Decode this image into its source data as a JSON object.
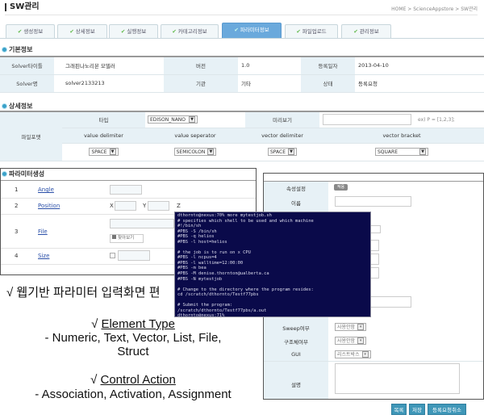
{
  "header": {
    "title": "SW관리",
    "breadcrumb": "HOME > ScienceAppstore > SW관리"
  },
  "tabs": [
    {
      "label": "생성정보"
    },
    {
      "label": "상세정보"
    },
    {
      "label": "실행정보"
    },
    {
      "label": "카테고리정보"
    },
    {
      "label": "파라미터정보",
      "active": true
    },
    {
      "label": "파일업로드"
    },
    {
      "label": "관리정보"
    }
  ],
  "basic": {
    "heading": "기본정보",
    "rows": [
      {
        "l1": "Solver타이틀",
        "v1": "그래핀나노리본 모델러",
        "l2": "버전",
        "v2": "1.0",
        "l3": "등록일자",
        "v3": "2013-04-10"
      },
      {
        "l1": "Solver명",
        "v1": "solver2133213",
        "l2": "기관",
        "v2": "기타",
        "l3": "상태",
        "v3": "등록요청"
      }
    ]
  },
  "detail": {
    "heading": "상세정보",
    "file_format": "파일포맷",
    "type_label": "타입",
    "type_value": "EDISON_NANO",
    "preview_label": "미리보기",
    "preview_value": "",
    "example": "ex) P = [1,2,3];",
    "cols": [
      "value delimiter",
      "value seperator",
      "vector delimiter",
      "vector bracket"
    ],
    "values": [
      "SPACE",
      "SEMICOLON",
      "SPACE",
      "SQUARE"
    ]
  },
  "params": {
    "heading": "파라미터생성",
    "rows": [
      {
        "no": "1",
        "name": "Angle"
      },
      {
        "no": "2",
        "name": "Position"
      },
      {
        "no": "3",
        "name": "File"
      },
      {
        "no": "4",
        "name": "Size"
      }
    ],
    "x": "X",
    "y": "Y",
    "z": "Z",
    "browse": "찾아보기"
  },
  "props": {
    "attr_label": "속성설정",
    "attr_btn": "적용",
    "name_label": "이름",
    "sweep_label": "Sweep여부",
    "sweep_value": "사용안함",
    "struct_label": "구조체여부",
    "struct_value": "사용안함",
    "gui_label": "GUI",
    "gui_value": "리스트박스",
    "desc_label": "설명"
  },
  "buttons": {
    "list": "목록",
    "save": "저장",
    "cancel": "등록요청취소"
  },
  "terminal": "dthornto@nexus:70% more mytestjob.sh\n# specifies which shell to be used and which machine\n#!/bin/sh\n#PBS -S /bin/sh\n#PBS -q helios\n#PBS -l host=helios\n\n# the job is to run on x CPU\n#PBS -l ncpus=4\n#PBS -l walltime=12:00:00\n#PBS -m bea\n#PBS -M denise.thornton@ualberta.ca\n#PBS -N mytestjob\n\n# Change to the directory where the program resides:\ncd /scratch/dthornto/Testf77pbs\n\n# Submit the program:\n/scratch/dthornto/Testf77pbs/a.out\ndthornto@nexus:71%",
  "overlay": {
    "line1": "√ 웹기반 파라미터 입력화면 편",
    "element_check": "√ ",
    "element_title": "Element Type",
    "element_items": "- Numeric,  Text, Vector, List,  File,",
    "element_items2": "Struct",
    "control_check": "√ ",
    "control_title": "Control Action",
    "control_items": "- Association, Activation, Assignment"
  }
}
